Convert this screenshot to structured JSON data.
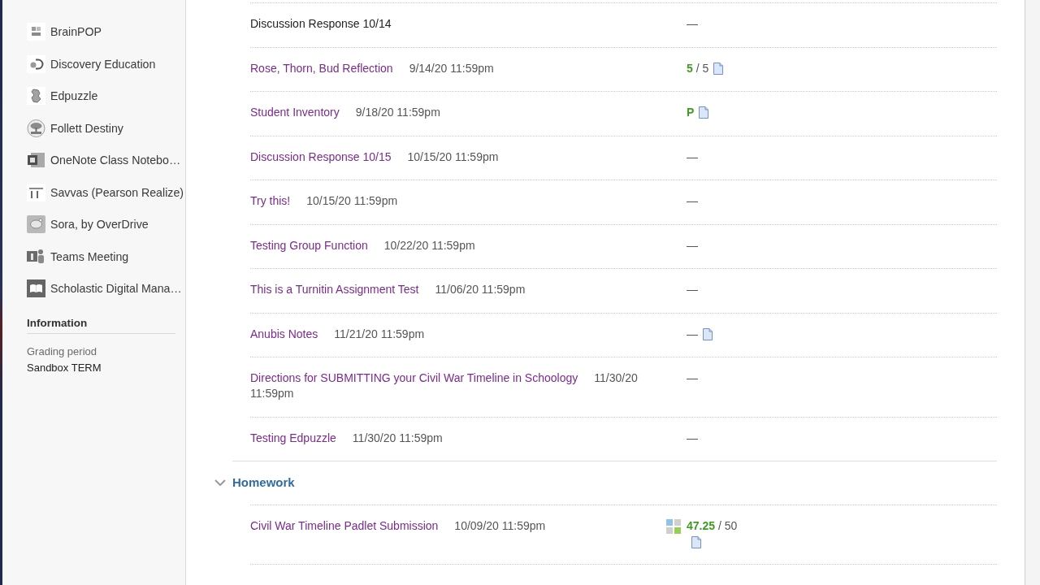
{
  "sidebar": {
    "items": [
      {
        "label": "BrainPOP"
      },
      {
        "label": "Discovery Education"
      },
      {
        "label": "Edpuzzle"
      },
      {
        "label": "Follett Destiny"
      },
      {
        "label": "OneNote Class Notebo…"
      },
      {
        "label": "Savvas (Pearson Realize)"
      },
      {
        "label": "Sora, by OverDrive"
      },
      {
        "label": "Teams Meeting"
      },
      {
        "label": "Scholastic Digital Mana…"
      }
    ],
    "information": {
      "heading": "Information",
      "fields": [
        {
          "label": "Grading period",
          "value": "Sandbox TERM"
        }
      ]
    }
  },
  "sections": [
    {
      "rows": [
        {
          "title": "Discussion Response 10/14",
          "link": false,
          "grade": {
            "value": "—",
            "graded": false
          },
          "attachment": false,
          "rubric": false
        },
        {
          "title": "Rose, Thorn, Bud Reflection",
          "link": true,
          "due": {
            "date": "9/14/20",
            "time": "11:59pm"
          },
          "grade": {
            "value": "5",
            "max": "/ 5",
            "graded": true
          },
          "attachment": true,
          "rubric": false
        },
        {
          "title": "Student Inventory",
          "link": true,
          "due": {
            "date": "9/18/20",
            "time": "11:59pm"
          },
          "grade": {
            "value": "P",
            "graded": true
          },
          "attachment": true,
          "rubric": false
        },
        {
          "title": "Discussion Response 10/15",
          "link": true,
          "due": {
            "date": "10/15/20",
            "time": "11:59pm"
          },
          "grade": {
            "value": "—",
            "graded": false
          },
          "attachment": false,
          "rubric": false
        },
        {
          "title": "Try this!",
          "link": true,
          "due": {
            "date": "10/15/20",
            "time": "11:59pm"
          },
          "grade": {
            "value": "—",
            "graded": false
          },
          "attachment": false,
          "rubric": false
        },
        {
          "title": "Testing Group Function",
          "link": true,
          "due": {
            "date": "10/22/20",
            "time": "11:59pm"
          },
          "grade": {
            "value": "—",
            "graded": false
          },
          "attachment": false,
          "rubric": false
        },
        {
          "title": "This is a Turnitin Assignment Test",
          "link": true,
          "due": {
            "date": "11/06/20",
            "time": "11:59pm"
          },
          "grade": {
            "value": "—",
            "graded": false
          },
          "attachment": false,
          "rubric": false
        },
        {
          "title": "Anubis Notes",
          "link": true,
          "due": {
            "date": "11/21/20",
            "time": "11:59pm"
          },
          "grade": {
            "value": "—",
            "graded": false
          },
          "attachment": true,
          "rubric": false
        },
        {
          "title": "Directions for SUBMITTING your Civil War Timeline in Schoology",
          "link": true,
          "due": {
            "date": "11/30/20",
            "time": "11:59pm"
          },
          "grade": {
            "value": "—",
            "graded": false
          },
          "attachment": false,
          "rubric": false
        },
        {
          "title": "Testing Edpuzzle",
          "link": true,
          "due": {
            "date": "11/30/20",
            "time": "11:59pm"
          },
          "grade": {
            "value": "—",
            "graded": false
          },
          "attachment": false,
          "rubric": false
        }
      ]
    },
    {
      "title": "Homework",
      "expanded": true,
      "rows": [
        {
          "title": "Civil War Timeline Padlet Submission",
          "link": true,
          "due": {
            "date": "10/09/20",
            "time": "11:59pm"
          },
          "grade": {
            "value": "47.25",
            "max": "/ 50",
            "graded": true
          },
          "attachment": true,
          "rubric": true
        }
      ]
    }
  ]
}
